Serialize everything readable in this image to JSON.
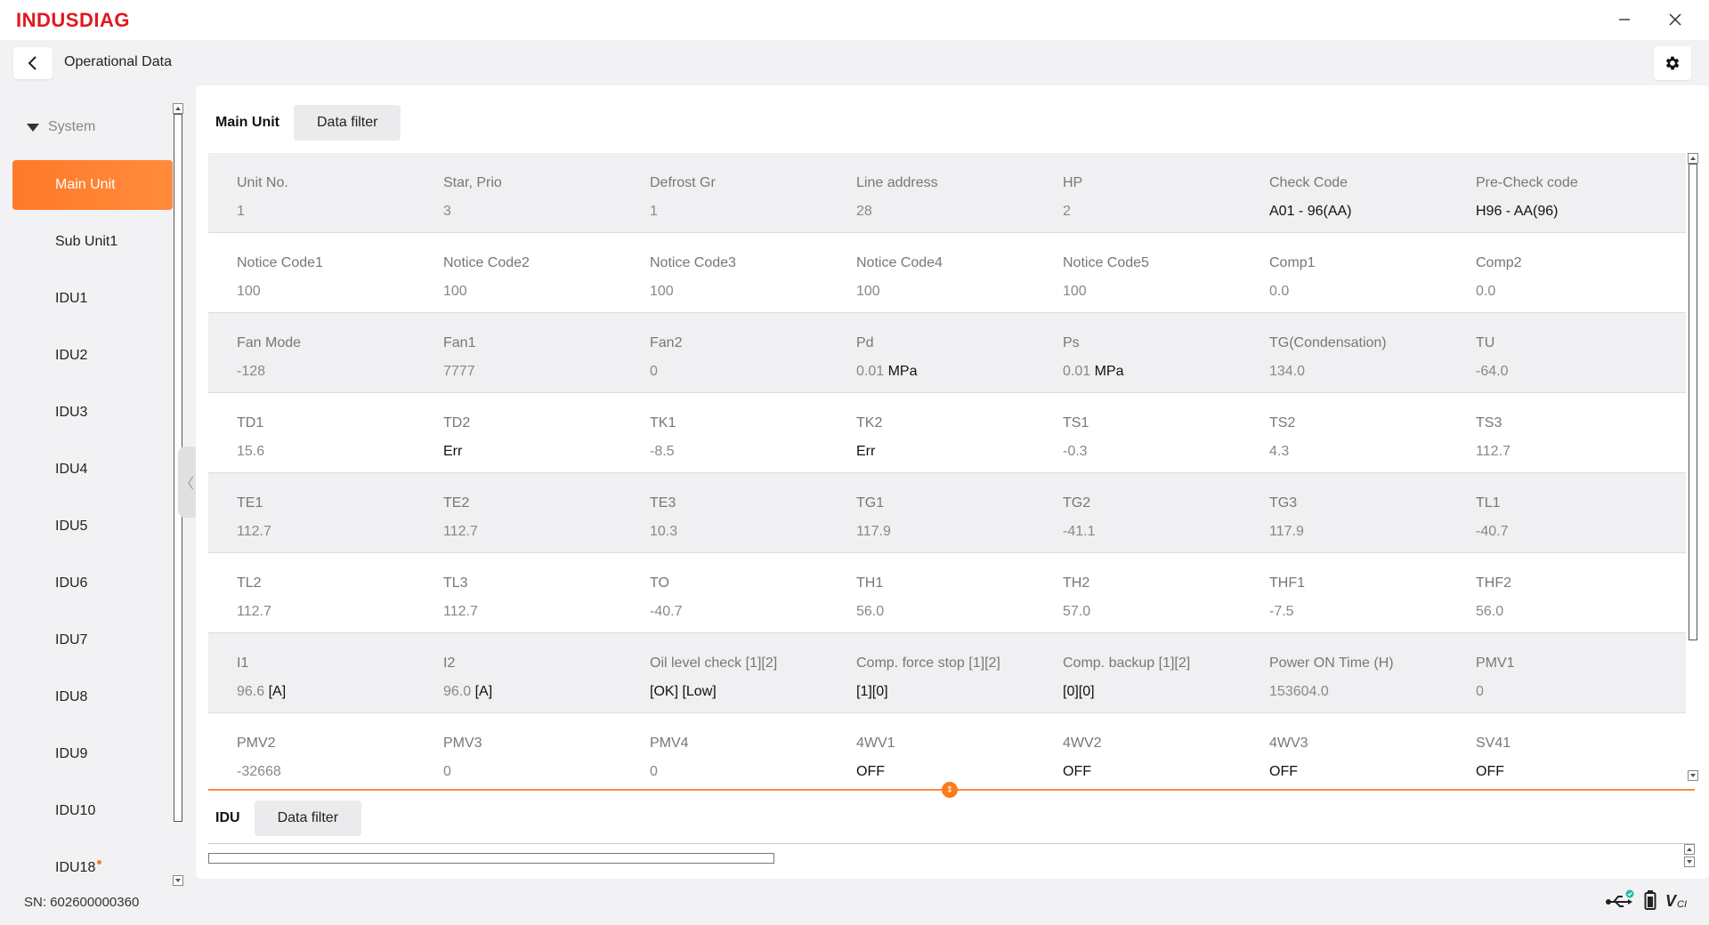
{
  "app": {
    "brand": "INDUSDIAG",
    "minimize_label": "—",
    "close_label": "✕"
  },
  "header": {
    "title": "Operational Data"
  },
  "sidebar": {
    "group_label": "System",
    "items": [
      {
        "label": "Main Unit",
        "active": true
      },
      {
        "label": "Sub Unit1"
      },
      {
        "label": "IDU1"
      },
      {
        "label": "IDU2"
      },
      {
        "label": "IDU3"
      },
      {
        "label": "IDU4"
      },
      {
        "label": "IDU5"
      },
      {
        "label": "IDU6"
      },
      {
        "label": "IDU7"
      },
      {
        "label": "IDU8"
      },
      {
        "label": "IDU9"
      },
      {
        "label": "IDU10"
      },
      {
        "label": "IDU18",
        "dot": true
      }
    ],
    "collapse_glyph": "〈"
  },
  "serial": "SN: 602600000360",
  "main_tabs": {
    "active": "Main Unit",
    "filter": "Data filter"
  },
  "grid": [
    [
      {
        "label": "Unit No.",
        "value": "1"
      },
      {
        "label": "Star, Prio",
        "value": "3"
      },
      {
        "label": "Defrost Gr",
        "value": "1"
      },
      {
        "label": "Line address",
        "value": "28"
      },
      {
        "label": "HP",
        "value": "2"
      },
      {
        "label": "Check Code",
        "value": "A01 - 96(AA)",
        "dark": true
      },
      {
        "label": "Pre-Check code",
        "value": "H96 - AA(96)",
        "dark": true
      }
    ],
    [
      {
        "label": "Notice Code1",
        "value": "100"
      },
      {
        "label": "Notice Code2",
        "value": "100"
      },
      {
        "label": "Notice Code3",
        "value": "100"
      },
      {
        "label": "Notice Code4",
        "value": "100"
      },
      {
        "label": "Notice Code5",
        "value": "100"
      },
      {
        "label": "Comp1",
        "value": "0.0"
      },
      {
        "label": "Comp2",
        "value": "0.0"
      }
    ],
    [
      {
        "label": "Fan Mode",
        "value": "-128"
      },
      {
        "label": "Fan1",
        "value": "7777"
      },
      {
        "label": "Fan2",
        "value": "0"
      },
      {
        "label": "Pd",
        "value": "0.01",
        "unit": "MPa"
      },
      {
        "label": "Ps",
        "value": "0.01",
        "unit": "MPa"
      },
      {
        "label": "TG(Condensation)",
        "value": "134.0"
      },
      {
        "label": "TU",
        "value": "-64.0"
      }
    ],
    [
      {
        "label": "TD1",
        "value": "15.6"
      },
      {
        "label": "TD2",
        "value": "Err",
        "dark": true
      },
      {
        "label": "TK1",
        "value": "-8.5"
      },
      {
        "label": "TK2",
        "value": "Err",
        "dark": true
      },
      {
        "label": "TS1",
        "value": "-0.3"
      },
      {
        "label": "TS2",
        "value": "4.3"
      },
      {
        "label": "TS3",
        "value": "112.7"
      }
    ],
    [
      {
        "label": "TE1",
        "value": "112.7"
      },
      {
        "label": "TE2",
        "value": "112.7"
      },
      {
        "label": "TE3",
        "value": "10.3"
      },
      {
        "label": "TG1",
        "value": "117.9"
      },
      {
        "label": "TG2",
        "value": "-41.1"
      },
      {
        "label": "TG3",
        "value": "117.9"
      },
      {
        "label": "TL1",
        "value": "-40.7"
      }
    ],
    [
      {
        "label": "TL2",
        "value": "112.7"
      },
      {
        "label": "TL3",
        "value": "112.7"
      },
      {
        "label": "TO",
        "value": "-40.7"
      },
      {
        "label": "TH1",
        "value": "56.0"
      },
      {
        "label": "TH2",
        "value": "57.0"
      },
      {
        "label": "THF1",
        "value": "-7.5"
      },
      {
        "label": "THF2",
        "value": "56.0"
      }
    ],
    [
      {
        "label": "I1",
        "value": "96.6",
        "unit": "[A]"
      },
      {
        "label": "I2",
        "value": "96.0",
        "unit": "[A]"
      },
      {
        "label": "Oil level check [1][2]",
        "value": "[OK] [Low]",
        "dark": true
      },
      {
        "label": "Comp. force stop [1][2]",
        "value": "[1][0]",
        "dark": true
      },
      {
        "label": "Comp. backup [1][2]",
        "value": "[0][0]",
        "dark": true
      },
      {
        "label": "Power ON Time (H)",
        "value": "153604.0"
      },
      {
        "label": "PMV1",
        "value": "0"
      }
    ],
    [
      {
        "label": "PMV2",
        "value": "-32668"
      },
      {
        "label": "PMV3",
        "value": "0"
      },
      {
        "label": "PMV4",
        "value": "0"
      },
      {
        "label": "4WV1",
        "value": "OFF",
        "dark": true
      },
      {
        "label": "4WV2",
        "value": "OFF",
        "dark": true
      },
      {
        "label": "4WV3",
        "value": "OFF",
        "dark": true
      },
      {
        "label": "SV41",
        "value": "OFF",
        "dark": true
      }
    ]
  ],
  "lower_tabs": {
    "active": "IDU",
    "filter": "Data filter"
  },
  "status_icons": [
    "usb-connected-icon",
    "battery-icon",
    "vci-icon"
  ],
  "colors": {
    "brand": "#e3161f",
    "accent": "#ff7a2a",
    "connected": "#19c0a0"
  }
}
